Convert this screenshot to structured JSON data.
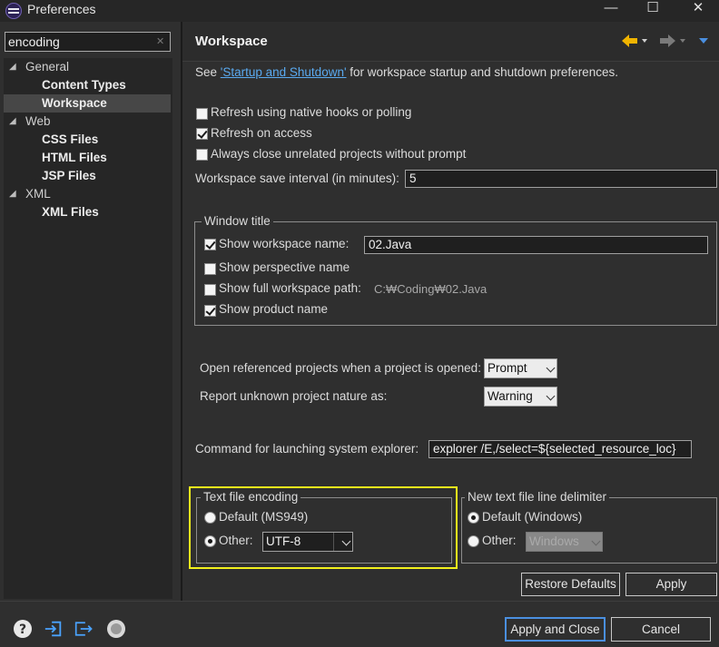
{
  "window": {
    "title": "Preferences",
    "controls": {
      "minimize": "—",
      "maximize": "☐",
      "close": "✕"
    }
  },
  "sidebar": {
    "filter_value": "encoding",
    "tree": [
      {
        "label": "General",
        "expanded": true,
        "children": [
          "Content Types",
          "Workspace"
        ]
      },
      {
        "label": "Web",
        "expanded": true,
        "children": [
          "CSS Files",
          "HTML Files",
          "JSP Files"
        ]
      },
      {
        "label": "XML",
        "expanded": true,
        "children": [
          "XML Files"
        ]
      }
    ],
    "selected": "Workspace"
  },
  "page": {
    "title": "Workspace",
    "intro_prefix": "See ",
    "intro_link": "'Startup and Shutdown'",
    "intro_suffix": " for workspace startup and shutdown preferences.",
    "options": {
      "refresh_native": {
        "label": "Refresh using native hooks or polling",
        "checked": false
      },
      "refresh_access": {
        "label": "Refresh on access",
        "checked": true
      },
      "close_unrelated": {
        "label": "Always close unrelated projects without prompt",
        "checked": false
      }
    },
    "save_interval_label": "Workspace save interval (in minutes):",
    "save_interval_value": "5",
    "window_title": {
      "legend": "Window title",
      "show_workspace_name": {
        "label": "Show workspace name:",
        "checked": true,
        "value": "02.Java"
      },
      "show_perspective_name": {
        "label": "Show perspective name",
        "checked": false
      },
      "show_full_path": {
        "label": "Show full workspace path:",
        "checked": false,
        "value": "C:₩Coding₩02.Java"
      },
      "show_product_name": {
        "label": "Show product name",
        "checked": true
      }
    },
    "open_referenced": {
      "label": "Open referenced projects when a project is opened:",
      "value": "Prompt"
    },
    "report_unknown": {
      "label": "Report unknown project nature as:",
      "value": "Warning"
    },
    "explorer": {
      "label": "Command for launching system explorer:",
      "value": "explorer /E,/select=${selected_resource_loc}"
    },
    "encoding": {
      "legend": "Text file encoding",
      "default_label": "Default (MS949)",
      "other_label": "Other:",
      "other_selected": true,
      "other_value": "UTF-8"
    },
    "delimiter": {
      "legend": "New text file line delimiter",
      "default_label": "Default (Windows)",
      "other_label": "Other:",
      "default_selected": true,
      "other_value": "Windows"
    },
    "restore_defaults": "Restore Defaults",
    "apply": "Apply"
  },
  "footer": {
    "icons": [
      "help-icon",
      "import-icon",
      "export-icon",
      "oomph-icon"
    ],
    "apply_and_close": "Apply and Close",
    "cancel": "Cancel"
  },
  "colors": {
    "background": "#2f2f2f",
    "tree_background": "#262626",
    "link": "#5aaaf0",
    "highlight": "#f2f01c",
    "nav_back_arrow": "#f0b400",
    "nav_menu_arrow": "#4a8fe0"
  }
}
